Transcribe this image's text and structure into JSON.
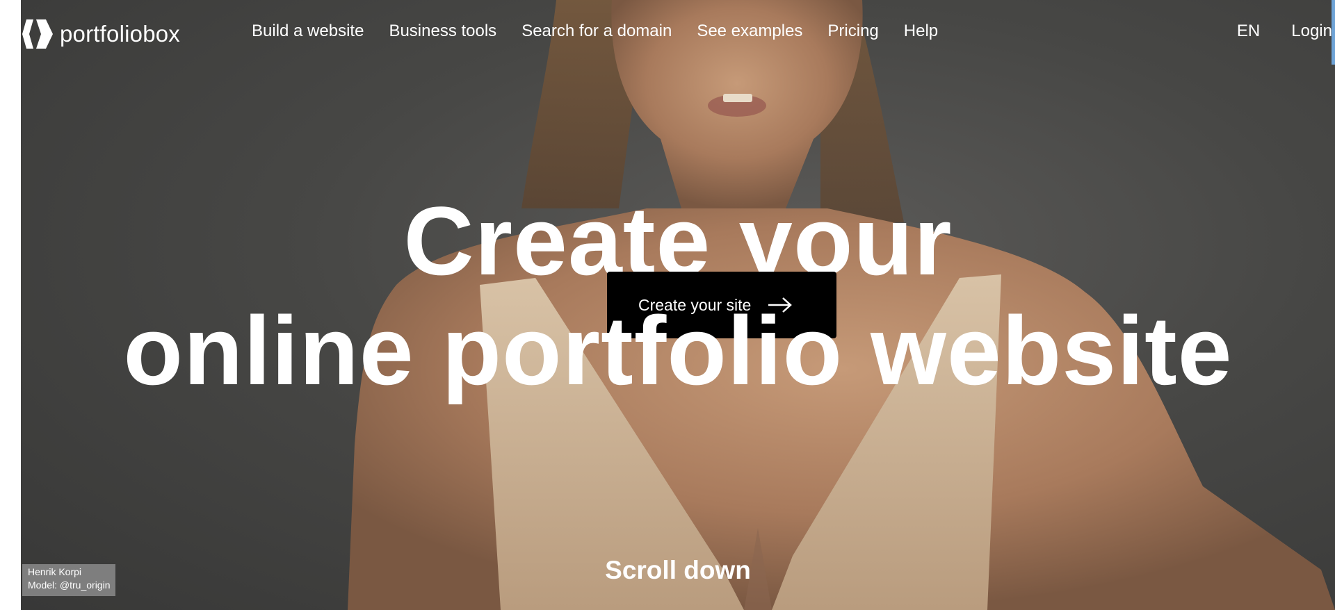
{
  "brand": {
    "name": "portfoliobox",
    "logo_icon": "portfoliobox-logo-icon"
  },
  "nav": {
    "links": [
      {
        "label": "Build a website"
      },
      {
        "label": "Business tools"
      },
      {
        "label": "Search for a domain"
      },
      {
        "label": "See examples"
      },
      {
        "label": "Pricing"
      },
      {
        "label": "Help"
      }
    ],
    "language": "EN",
    "login": "Login"
  },
  "hero": {
    "headline_line1": "Create your",
    "headline_line2": "online portfolio website",
    "cta_label": "Create your site",
    "cta_icon": "arrow-right-icon",
    "scroll_label": "Scroll down"
  },
  "credit": {
    "photographer": "Henrik Korpi",
    "model": "Model: @tru_origin"
  },
  "colors": {
    "background": "#474745",
    "text": "#ffffff",
    "cta_background": "#000000",
    "accent": "#6ea3d6"
  }
}
